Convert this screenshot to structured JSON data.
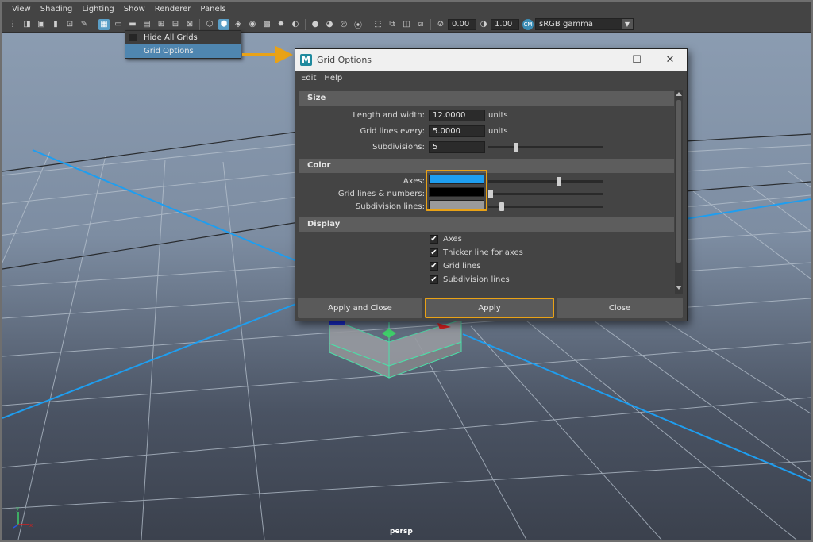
{
  "menubar": {
    "items": [
      "View",
      "Shading",
      "Lighting",
      "Show",
      "Renderer",
      "Panels"
    ]
  },
  "toolbar": {
    "exposure_value": "0.00",
    "gamma_value": "1.00",
    "color_space": "sRGB gamma"
  },
  "dropdown": {
    "items": [
      {
        "label": "Hide All Grids",
        "checked": false,
        "selected": false
      },
      {
        "label": "Grid Options",
        "checked": false,
        "selected": true
      }
    ]
  },
  "viewport": {
    "label": "persp",
    "axis_x": "x",
    "axis_y": "y"
  },
  "dialog": {
    "title": "Grid Options",
    "logo": "M",
    "menu": [
      "Edit",
      "Help"
    ],
    "size": {
      "header": "Size",
      "length_label": "Length and width:",
      "length_value": "12.0000",
      "length_unit": "units",
      "every_label": "Grid lines every:",
      "every_value": "5.0000",
      "every_unit": "units",
      "subdiv_label": "Subdivisions:",
      "subdiv_value": "5",
      "subdiv_slider_fraction": 0.23
    },
    "color": {
      "header": "Color",
      "axes_label": "Axes:",
      "axes_color": "#1e9ef0",
      "axes_slider_fraction": 0.62,
      "gridlines_label": "Grid lines & numbers:",
      "gridlines_color": "#000000",
      "gridlines_slider_fraction": 0.0,
      "subdiv_label": "Subdivision lines:",
      "subdiv_color": "#9a9a9a",
      "subdiv_slider_fraction": 0.1
    },
    "display": {
      "header": "Display",
      "checkboxes": [
        {
          "label": "Axes",
          "checked": true
        },
        {
          "label": "Thicker line for axes",
          "checked": true
        },
        {
          "label": "Grid lines",
          "checked": true
        },
        {
          "label": "Subdivision lines",
          "checked": true
        }
      ]
    },
    "buttons": {
      "apply_close": "Apply and Close",
      "apply": "Apply",
      "close": "Close"
    }
  },
  "colors": {
    "highlight": "#e9a216",
    "grid_axis": "#1e9ef0",
    "selection": "#4f86b0"
  }
}
